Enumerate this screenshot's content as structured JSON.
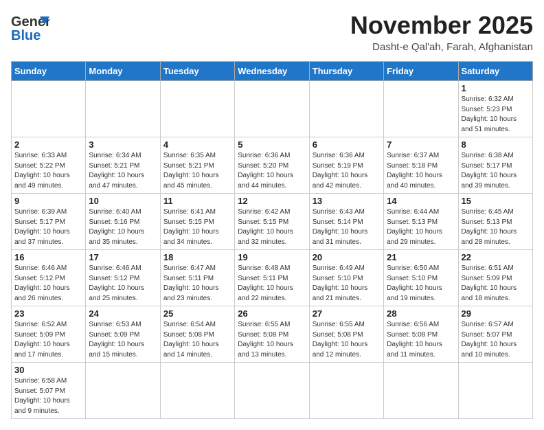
{
  "header": {
    "logo_general": "General",
    "logo_blue": "Blue",
    "title": "November 2025",
    "subtitle": "Dasht-e Qal'ah, Farah, Afghanistan"
  },
  "weekdays": [
    "Sunday",
    "Monday",
    "Tuesday",
    "Wednesday",
    "Thursday",
    "Friday",
    "Saturday"
  ],
  "weeks": [
    [
      {
        "day": "",
        "info": ""
      },
      {
        "day": "",
        "info": ""
      },
      {
        "day": "",
        "info": ""
      },
      {
        "day": "",
        "info": ""
      },
      {
        "day": "",
        "info": ""
      },
      {
        "day": "",
        "info": ""
      },
      {
        "day": "1",
        "info": "Sunrise: 6:32 AM\nSunset: 5:23 PM\nDaylight: 10 hours and 51 minutes."
      }
    ],
    [
      {
        "day": "2",
        "info": "Sunrise: 6:33 AM\nSunset: 5:22 PM\nDaylight: 10 hours and 49 minutes."
      },
      {
        "day": "3",
        "info": "Sunrise: 6:34 AM\nSunset: 5:21 PM\nDaylight: 10 hours and 47 minutes."
      },
      {
        "day": "4",
        "info": "Sunrise: 6:35 AM\nSunset: 5:21 PM\nDaylight: 10 hours and 45 minutes."
      },
      {
        "day": "5",
        "info": "Sunrise: 6:36 AM\nSunset: 5:20 PM\nDaylight: 10 hours and 44 minutes."
      },
      {
        "day": "6",
        "info": "Sunrise: 6:36 AM\nSunset: 5:19 PM\nDaylight: 10 hours and 42 minutes."
      },
      {
        "day": "7",
        "info": "Sunrise: 6:37 AM\nSunset: 5:18 PM\nDaylight: 10 hours and 40 minutes."
      },
      {
        "day": "8",
        "info": "Sunrise: 6:38 AM\nSunset: 5:17 PM\nDaylight: 10 hours and 39 minutes."
      }
    ],
    [
      {
        "day": "9",
        "info": "Sunrise: 6:39 AM\nSunset: 5:17 PM\nDaylight: 10 hours and 37 minutes."
      },
      {
        "day": "10",
        "info": "Sunrise: 6:40 AM\nSunset: 5:16 PM\nDaylight: 10 hours and 35 minutes."
      },
      {
        "day": "11",
        "info": "Sunrise: 6:41 AM\nSunset: 5:15 PM\nDaylight: 10 hours and 34 minutes."
      },
      {
        "day": "12",
        "info": "Sunrise: 6:42 AM\nSunset: 5:15 PM\nDaylight: 10 hours and 32 minutes."
      },
      {
        "day": "13",
        "info": "Sunrise: 6:43 AM\nSunset: 5:14 PM\nDaylight: 10 hours and 31 minutes."
      },
      {
        "day": "14",
        "info": "Sunrise: 6:44 AM\nSunset: 5:13 PM\nDaylight: 10 hours and 29 minutes."
      },
      {
        "day": "15",
        "info": "Sunrise: 6:45 AM\nSunset: 5:13 PM\nDaylight: 10 hours and 28 minutes."
      }
    ],
    [
      {
        "day": "16",
        "info": "Sunrise: 6:46 AM\nSunset: 5:12 PM\nDaylight: 10 hours and 26 minutes."
      },
      {
        "day": "17",
        "info": "Sunrise: 6:46 AM\nSunset: 5:12 PM\nDaylight: 10 hours and 25 minutes."
      },
      {
        "day": "18",
        "info": "Sunrise: 6:47 AM\nSunset: 5:11 PM\nDaylight: 10 hours and 23 minutes."
      },
      {
        "day": "19",
        "info": "Sunrise: 6:48 AM\nSunset: 5:11 PM\nDaylight: 10 hours and 22 minutes."
      },
      {
        "day": "20",
        "info": "Sunrise: 6:49 AM\nSunset: 5:10 PM\nDaylight: 10 hours and 21 minutes."
      },
      {
        "day": "21",
        "info": "Sunrise: 6:50 AM\nSunset: 5:10 PM\nDaylight: 10 hours and 19 minutes."
      },
      {
        "day": "22",
        "info": "Sunrise: 6:51 AM\nSunset: 5:09 PM\nDaylight: 10 hours and 18 minutes."
      }
    ],
    [
      {
        "day": "23",
        "info": "Sunrise: 6:52 AM\nSunset: 5:09 PM\nDaylight: 10 hours and 17 minutes."
      },
      {
        "day": "24",
        "info": "Sunrise: 6:53 AM\nSunset: 5:09 PM\nDaylight: 10 hours and 15 minutes."
      },
      {
        "day": "25",
        "info": "Sunrise: 6:54 AM\nSunset: 5:08 PM\nDaylight: 10 hours and 14 minutes."
      },
      {
        "day": "26",
        "info": "Sunrise: 6:55 AM\nSunset: 5:08 PM\nDaylight: 10 hours and 13 minutes."
      },
      {
        "day": "27",
        "info": "Sunrise: 6:55 AM\nSunset: 5:08 PM\nDaylight: 10 hours and 12 minutes."
      },
      {
        "day": "28",
        "info": "Sunrise: 6:56 AM\nSunset: 5:08 PM\nDaylight: 10 hours and 11 minutes."
      },
      {
        "day": "29",
        "info": "Sunrise: 6:57 AM\nSunset: 5:07 PM\nDaylight: 10 hours and 10 minutes."
      }
    ],
    [
      {
        "day": "30",
        "info": "Sunrise: 6:58 AM\nSunset: 5:07 PM\nDaylight: 10 hours and 9 minutes."
      },
      {
        "day": "",
        "info": ""
      },
      {
        "day": "",
        "info": ""
      },
      {
        "day": "",
        "info": ""
      },
      {
        "day": "",
        "info": ""
      },
      {
        "day": "",
        "info": ""
      },
      {
        "day": "",
        "info": ""
      }
    ]
  ]
}
